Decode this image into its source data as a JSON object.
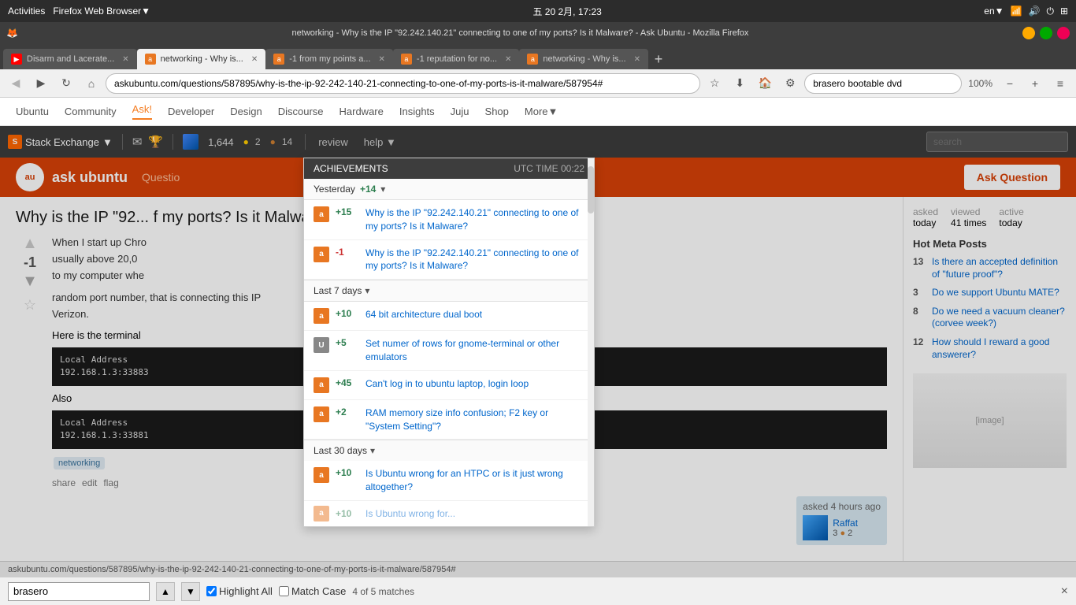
{
  "system_bar": {
    "left": "Activities",
    "browser_name": "Firefox Web Browser▼",
    "center_date": "五 20  2月, 17:23",
    "lang": "en▼",
    "wifi_icon": "wifi",
    "sound_icon": "sound",
    "power_icon": "power"
  },
  "title_bar": {
    "title": "networking - Why is the IP \"92.242.140.21\" connecting to one of my ports? Is it Malware? - Ask Ubuntu - Mozilla Firefox",
    "close": "×",
    "min": "−",
    "max": "□"
  },
  "tabs": [
    {
      "id": "tab1",
      "label": "Disarm and Lacerate...",
      "favicon": "yt",
      "active": false
    },
    {
      "id": "tab2",
      "label": "networking - Why is...",
      "favicon": "ask",
      "active": true
    },
    {
      "id": "tab3",
      "label": "-1 from my points a...",
      "favicon": "ask",
      "active": false
    },
    {
      "id": "tab4",
      "label": "-1 reputation for no...",
      "favicon": "ask",
      "active": false
    },
    {
      "id": "tab5",
      "label": "networking - Why is...",
      "favicon": "ask",
      "active": false
    }
  ],
  "nav_bar": {
    "url": "askubuntu.com/questions/587895/why-is-the-ip-92-242-140-21-connecting-to-one-of-my-ports-is-it-malware/587954#",
    "search": "brasero bootable dvd",
    "zoom": "100%"
  },
  "site_nav": {
    "items": [
      "Ubuntu",
      "Community",
      "Ask!",
      "Developer",
      "Design",
      "Discourse",
      "Hardware",
      "Insights",
      "Juju",
      "Shop",
      "More▼"
    ]
  },
  "se_bar": {
    "logo": "Stack Exchange",
    "dropdown_arrow": "▼",
    "inbox": "✉",
    "user_rep": "1,644",
    "gold": "2",
    "bronze": "14",
    "review": "review",
    "help": "help ▼",
    "search_placeholder": "search"
  },
  "au_header": {
    "logo_text": "ask ubuntu",
    "logo_abbr": "au",
    "section_label": "Questio",
    "ask_btn": "Ask Question"
  },
  "question": {
    "title": "Why is the IP \"92...f my ports? Is it Malware?",
    "full_title": "Why is the IP \"92.242.140.21\" connecting to one of my ports? Is it Malware?",
    "vote_count": "-1",
    "body_text": "When I start up Chro...usually above 20,0...to my computer whe...",
    "body_line1": "When I start up Chro",
    "body_line2": "usually above 20,0",
    "body_line3": "to my computer whe",
    "body_para": "random port number, that is connecting this IP Verizon.",
    "code_line1": "Local Address",
    "code_val1": "192.168.1.3:33883",
    "code_line2": "Also",
    "code_line3": "Local Address",
    "code_val2": "192.168.1.3:33881",
    "tag": "networking",
    "actions": {
      "share": "share",
      "edit": "edit",
      "flag": "flag"
    }
  },
  "meta_stats": {
    "asked_label": "asked",
    "asked_value": "today",
    "viewed_label": "viewed",
    "viewed_value": "41 times",
    "active_label": "active",
    "active_value": "today"
  },
  "hot_meta": {
    "title": "Hot Meta Posts",
    "items": [
      {
        "num": "13",
        "text": "Is there an accepted definition of \"future proof\"?"
      },
      {
        "num": "3",
        "text": "Do we support Ubuntu MATE?"
      },
      {
        "num": "8",
        "text": "Do we need a vacuum cleaner? (corvee week?)"
      },
      {
        "num": "12",
        "text": "How should I reward a good answerer?"
      }
    ]
  },
  "achievements": {
    "title": "ACHIEVEMENTS",
    "utc": "UTC TIME 00:22",
    "scrollbar": true,
    "yesterday": {
      "label": "Yesterday",
      "delta": "+14",
      "items": [
        {
          "icon_type": "ask",
          "rep": "+15",
          "is_neg": false,
          "title": "Why is the IP \"92.242.140.21\" connecting to one of my ports? Is it Malware?",
          "site": "ask"
        },
        {
          "icon_type": "ask",
          "rep": "-1",
          "is_neg": true,
          "title": "Why is the IP \"92.242.140.21\" connecting to one of my ports? Is it Malware?",
          "site": "ask"
        }
      ]
    },
    "last7": {
      "label": "Last 7 days",
      "arrow": "▾",
      "items": [
        {
          "icon_type": "ask",
          "rep": "+10",
          "title": "64 bit architecture dual boot",
          "is_neg": false
        },
        {
          "icon_type": "ul",
          "rep": "+5",
          "title": "Set numer of rows for gnome-terminal or other emulators",
          "is_neg": false
        },
        {
          "icon_type": "ask",
          "rep": "+45",
          "title": "Can't log in to ubuntu laptop, login loop",
          "is_neg": false
        },
        {
          "icon_type": "ask",
          "rep": "+2",
          "title": "RAM memory size info confusion; F2 key or \"System Setting\"?",
          "is_neg": false
        }
      ]
    },
    "last30": {
      "label": "Last 30 days",
      "arrow": "▾",
      "items": [
        {
          "icon_type": "ask",
          "rep": "+10",
          "title": "Is Ubuntu wrong for an HTPC or is it just wrong altogether?",
          "is_neg": false
        }
      ]
    }
  },
  "find_bar": {
    "input_value": "brasero",
    "highlight_all": "Highlight All",
    "match_case": "Match Case",
    "matches": "4 of 5 matches",
    "close": "×",
    "up_arrow": "▲",
    "down_arrow": "▼"
  },
  "bottom_url": "askubuntu.com/questions/587895/why-is-the-ip-92-242-140-21-connecting-to-one-of-my-ports-is-it-malware/587954#",
  "asked_info": {
    "text": "asked 4 hours ago",
    "user": "Raffat",
    "rep": "3",
    "badge_bronze": "2"
  }
}
